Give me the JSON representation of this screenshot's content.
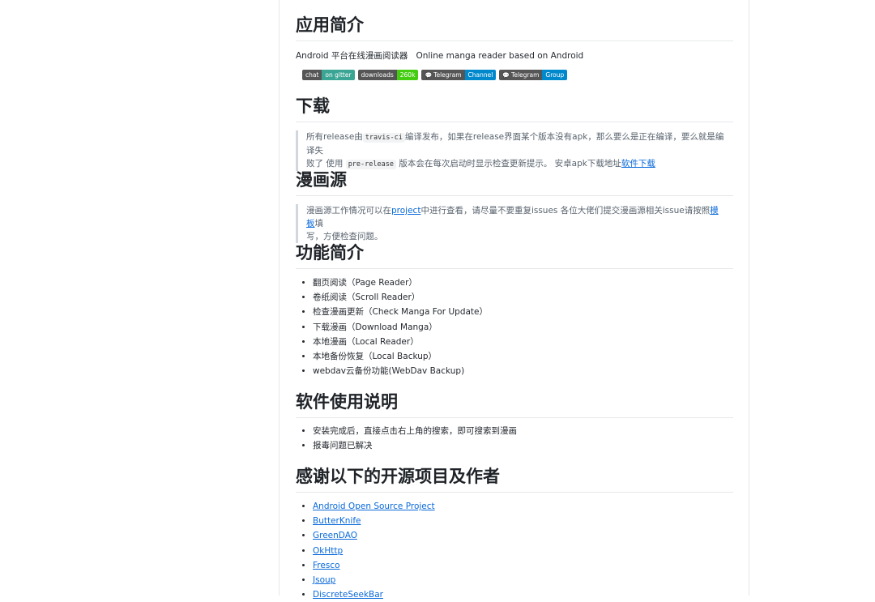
{
  "sections": {
    "intro": {
      "title": "应用简介",
      "desc_cn": "Android 平台在线漫画阅读器",
      "desc_en": "Online manga reader based on Android"
    },
    "badges": [
      {
        "left": "chat",
        "right": "on gitter",
        "color": "#3aa594"
      },
      {
        "left": "downloads",
        "right": "260k",
        "color": "#44cc11"
      },
      {
        "left": "Telegram",
        "right": "Channel",
        "color": "#0088cc"
      },
      {
        "left": "Telegram",
        "right": "Group",
        "color": "#0088cc"
      }
    ],
    "download": {
      "title": "下载",
      "t1": "所有release由",
      "code1": "travis-ci",
      "t2": "编译发布，如果在release界面某个版本没有apk，那么要么是正在编译，要么就是编译失",
      "t3": "败了 使用",
      "code2": "pre-release",
      "t4": "版本会在每次启动时显示检查更新提示。 安卓apk下载地址",
      "link": "软件下载"
    },
    "source": {
      "title": "漫画源",
      "t1": "漫画源工作情况可以在",
      "link1": "project",
      "t2": "中进行查看，请尽量不要重复issues 各位大佬们提交漫画源相关issue请按照",
      "link2": "模板",
      "t3": "填",
      "t4": "写，方便检查问题。"
    },
    "features": {
      "title": "功能简介",
      "items": [
        "翻页阅读（Page Reader）",
        "卷纸阅读（Scroll Reader）",
        "检查漫画更新（Check Manga For Update）",
        "下载漫画（Download Manga）",
        "本地漫画（Local Reader）",
        "本地备份恢复（Local Backup）",
        "webdav云备份功能(WebDav Backup)"
      ]
    },
    "usage": {
      "title": "软件使用说明",
      "items": [
        "安装完成后，直接点击右上角的搜索，即可搜索到漫画",
        "报毒问题已解决"
      ]
    },
    "thanks": {
      "title": "感谢以下的开源项目及作者",
      "items": [
        "Android Open Source Project",
        "ButterKnife",
        "GreenDAO",
        "OkHttp",
        "Fresco",
        "Jsoup",
        "DiscreteSeekBar"
      ]
    }
  }
}
